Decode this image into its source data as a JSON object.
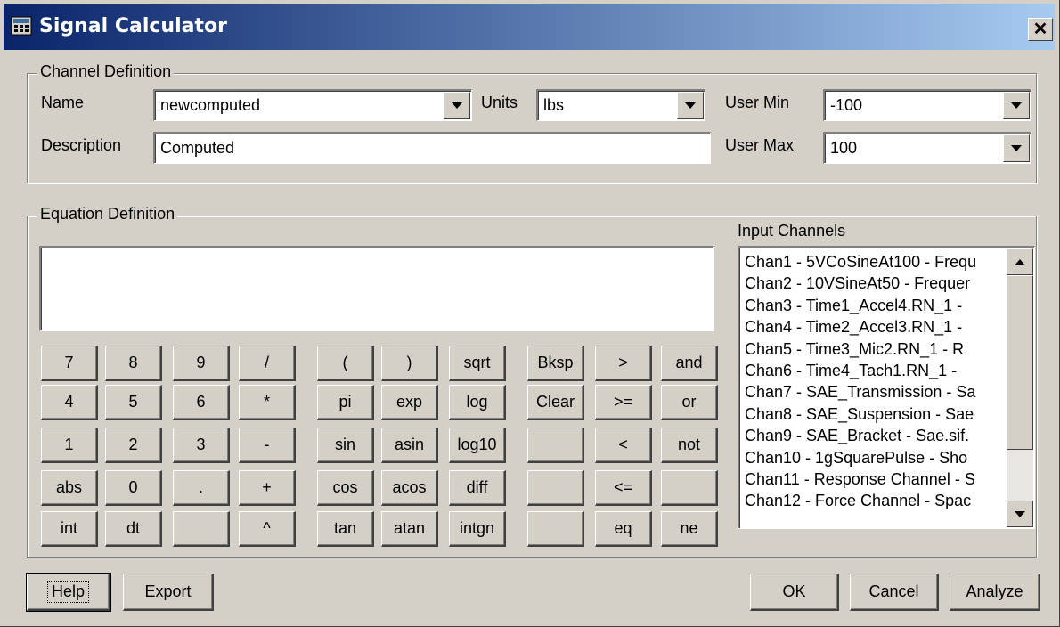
{
  "window": {
    "title": "Signal Calculator",
    "close_glyph": "✕"
  },
  "channel_definition": {
    "legend": "Channel Definition",
    "name_label": "Name",
    "name_value": "newcomputed",
    "units_label": "Units",
    "units_value": "lbs",
    "user_min_label": "User Min",
    "user_min_value": "-100",
    "description_label": "Description",
    "description_value": "Computed",
    "user_max_label": "User Max",
    "user_max_value": "100"
  },
  "equation_definition": {
    "legend": "Equation Definition",
    "equation_value": "",
    "keypad": [
      [
        "7",
        "8",
        "9",
        "/",
        "(",
        ")",
        "sqrt",
        "Bksp",
        ">",
        "and"
      ],
      [
        "4",
        "5",
        "6",
        "*",
        "pi",
        "exp",
        "log",
        "Clear",
        ">=",
        "or"
      ],
      [
        "1",
        "2",
        "3",
        "-",
        "sin",
        "asin",
        "log10",
        "",
        "<",
        "not"
      ],
      [
        "abs",
        "0",
        ".",
        "+",
        "cos",
        "acos",
        "diff",
        "",
        "<=",
        ""
      ],
      [
        "int",
        "dt",
        "",
        "^",
        "tan",
        "atan",
        "intgn",
        "",
        "eq",
        "ne"
      ]
    ],
    "input_channels_label": "Input Channels",
    "input_channels": [
      "Chan1 - 5VCoSineAt100 - Frequ",
      "Chan2 - 10VSineAt50 - Frequer",
      "Chan3 - Time1_Accel4.RN_1 - ",
      "Chan4 - Time2_Accel3.RN_1 - ",
      "Chan5 - Time3_Mic2.RN_1 - R",
      "Chan6 - Time4_Tach1.RN_1 - ",
      "Chan7 - SAE_Transmission - Sa",
      "Chan8 - SAE_Suspension - Sae",
      "Chan9 - SAE_Bracket - Sae.sif.",
      "Chan10 - 1gSquarePulse - Sho",
      "Chan11 - Response Channel - S",
      "Chan12 - Force Channel - Spac"
    ]
  },
  "footer": {
    "help_label": "Help",
    "export_label": "Export",
    "ok_label": "OK",
    "cancel_label": "Cancel",
    "analyze_label": "Analyze"
  }
}
